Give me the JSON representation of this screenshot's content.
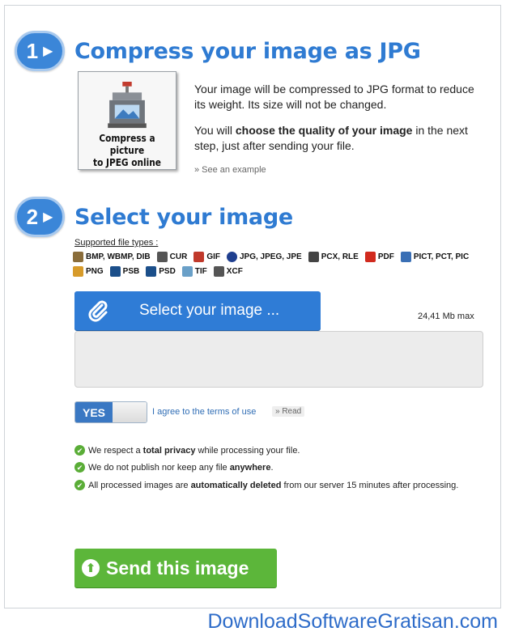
{
  "step1": {
    "num": "1",
    "title": "Compress your image as JPG"
  },
  "thumbnail": {
    "caption_line1": "Compress a picture",
    "caption_line2": "to JPEG online"
  },
  "description": {
    "p1": "Your image will be compressed to JPG format to reduce its weight. Its size will not be changed.",
    "p2_pre": "You will ",
    "p2_bold": "choose the quality of your image",
    "p2_post": " in the next step, just after sending your file.",
    "see_example": "» See an example"
  },
  "step2": {
    "num": "2",
    "title": "Select your image"
  },
  "supported": {
    "label": "Supported file types :",
    "row1": [
      {
        "label": "BMP, WBMP, DIB",
        "icon": "bmp-icon",
        "color": "#8a6d3b"
      },
      {
        "label": "CUR",
        "icon": "cursor-icon",
        "color": "#555555"
      },
      {
        "label": "GIF",
        "icon": "gif-icon",
        "color": "#c0392b"
      },
      {
        "label": "JPG, JPEG, JPE",
        "icon": "jpg-icon",
        "color": "#1f3f8f"
      },
      {
        "label": "PCX, RLE",
        "icon": "pcx-icon",
        "color": "#444444"
      },
      {
        "label": "PDF",
        "icon": "pdf-icon",
        "color": "#d12a1e"
      },
      {
        "label": "PICT, PCT, PIC",
        "icon": "pict-icon",
        "color": "#3a6fb5"
      }
    ],
    "row2": [
      {
        "label": "PNG",
        "icon": "png-icon",
        "color": "#d79b2a"
      },
      {
        "label": "PSB",
        "icon": "psb-icon",
        "color": "#1b4f8a"
      },
      {
        "label": "PSD",
        "icon": "psd-icon",
        "color": "#1b4f8a"
      },
      {
        "label": "TIF",
        "icon": "tif-icon",
        "color": "#6aa0c8"
      },
      {
        "label": "XCF",
        "icon": "xcf-icon",
        "color": "#555555"
      }
    ]
  },
  "upload": {
    "button_label": "Select your image ...",
    "max_size": "24,41 Mb max"
  },
  "terms": {
    "toggle_label": "YES",
    "agree_text": "I agree to the terms of use",
    "read_text": "» Read"
  },
  "privacy": [
    {
      "pre": "We respect a ",
      "bold": "total privacy",
      "post": " while processing your file."
    },
    {
      "pre": "We do not publish nor keep any file ",
      "bold": "anywhere",
      "post": "."
    },
    {
      "pre": "All processed images are ",
      "bold": "automatically deleted",
      "post": " from our server 15 minutes after processing."
    }
  ],
  "send": {
    "label": "Send this image"
  },
  "watermark": "DownloadSoftwareGratisan.com",
  "colors": {
    "accent_blue": "#2f7cd6",
    "send_green": "#5cb63a",
    "check_green": "#5aad37"
  }
}
